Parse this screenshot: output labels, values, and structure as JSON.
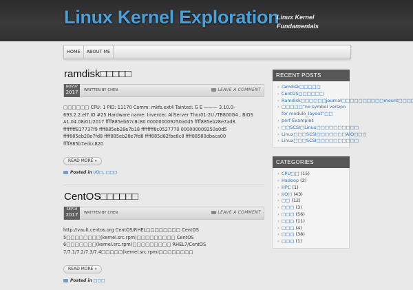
{
  "site": {
    "title": "Linux Kernel Exploration",
    "tagline": "Linux Kernel Fundamentals"
  },
  "nav": [
    {
      "label": "HOME"
    },
    {
      "label": "ABOUT ME"
    }
  ],
  "posts": [
    {
      "title": "ramdisk□□□□□",
      "date_month_day": "NOV07",
      "date_year": "2017",
      "author_line": "WRITTEN BY CHEN",
      "comment_link": "LEAVE A COMMENT",
      "excerpt": "□□□□□□ CPU: 1 PID: 11170 Comm: mkfs.ext4 Tainted: G E ——— 3.10.0-693.2.2.el7.IO #25 Hardware name: Inventec AllServer Thor01-2U /TB800G4 , BIOS A1.04 08/01/2017 ffff885eb67c8c80 000000009250a0d5 ffff885eb28e7ad8 ffffffff817737f9 ffff885eb28e7b18 ffffffff8c0527770 000000009250a0d5 ffff885eb28e7fd8 ffff885eb28e7fd8 ffff885d82fbe8c8 ffff88580dbaca00 ffff885b7edcc820",
      "read_more": "READ MORE »",
      "posted_in_label": "Posted in",
      "categories": "I/O□, □□□"
    },
    {
      "title": "CentOS□□□□□□",
      "date_month_day": "SEP18",
      "date_year": "2017",
      "author_line": "WRITTEN BY CHEN",
      "comment_link": "LEAVE A COMMENT",
      "excerpt": "http://vault.centos.org CentOS/RHEL□□□□□□□□ CentOS 5□□□□□□□□(kernel.src.rpm)□□□□□□□□□ CentOS 6□□□□□□□(kernel.src.rpm)□□□□□□□□□ RHEL7/CentOS 7/7.1/7.2/7.3/7.4□□□□□(kernel.src.rpm)□□□□□□□□",
      "read_more": "READ MORE »",
      "posted_in_label": "Posted in",
      "categories": "□□□"
    }
  ],
  "sidebar": {
    "recent_title": "RECENT POSTS",
    "recent": [
      "ramdisk□□□□□",
      "CentOS□□□□□□",
      "Ramdisk□□□□□□journal□□□□□□□□□□mount□□□□□□",
      "□□□□□“no symbol version for module_layout”□□",
      "perf Examples",
      "□□SCSI□Linux□□□□□□□□□□",
      "Linux□□□SCSI□□□□□□□AIO□□□",
      "Linux□□□SCSI□□□□□□□□□□"
    ],
    "categories_title": "CATEGORIES",
    "categories": [
      {
        "name": "CPU□□",
        "count": "(15)"
      },
      {
        "name": "Hadoop",
        "count": "(2)"
      },
      {
        "name": "HPC",
        "count": "(1)"
      },
      {
        "name": "I/O□",
        "count": "(43)"
      },
      {
        "name": "□□",
        "count": "(12)"
      },
      {
        "name": "□□□",
        "count": "(3)"
      },
      {
        "name": "□□□",
        "count": "(56)"
      },
      {
        "name": "□□□",
        "count": "(11)"
      },
      {
        "name": "□□□",
        "count": "(4)"
      },
      {
        "name": "□□□",
        "count": "(38)"
      },
      {
        "name": "□□□",
        "count": "(1)"
      }
    ]
  }
}
